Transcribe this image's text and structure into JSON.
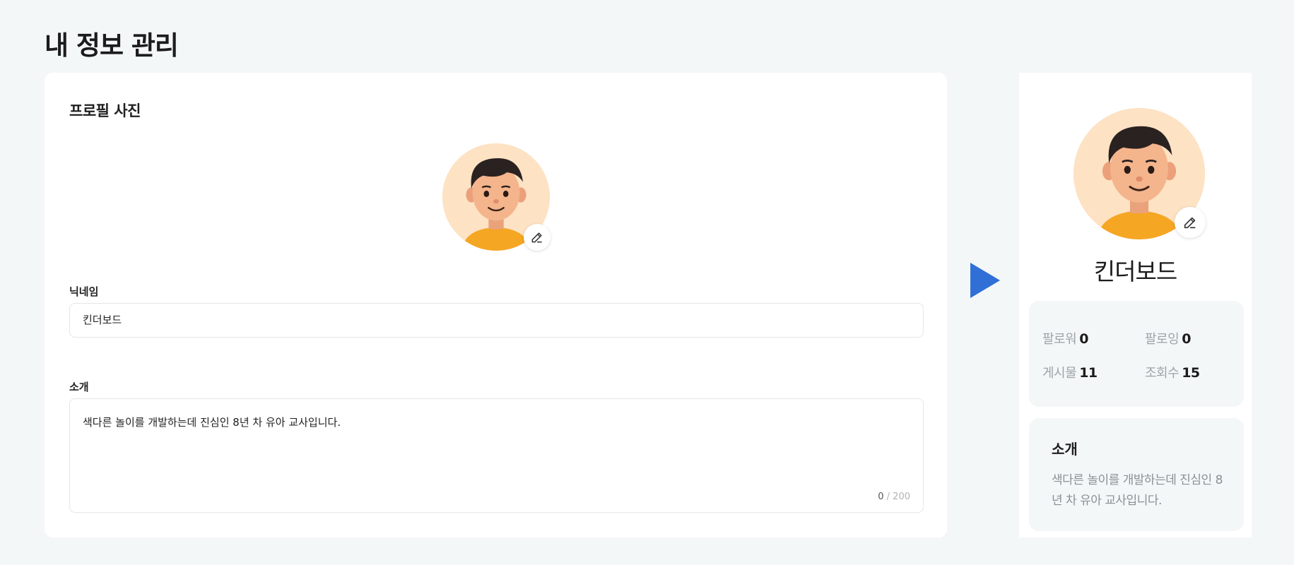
{
  "page": {
    "title": "내 정보 관리"
  },
  "profile_photo": {
    "section_title": "프로필 사진",
    "edit_icon": "pencil-icon"
  },
  "nickname": {
    "label": "닉네임",
    "value": "킨더보드"
  },
  "intro": {
    "label": "소개",
    "value": "색다른 놀이를 개발하는데 진심인 8년 차 유아 교사입니다.",
    "count_current": "0",
    "count_max": "/ 200"
  },
  "preview": {
    "name": "킨더보드",
    "stats": {
      "followers_label": "팔로워",
      "followers_value": "0",
      "following_label": "팔로잉",
      "following_value": "0",
      "posts_label": "게시물",
      "posts_value": "11",
      "views_label": "조회수",
      "views_value": "15"
    },
    "intro_title": "소개",
    "intro_text": "색다른 놀이를 개발하는데 진심인 8년 차 유아 교사입니다."
  },
  "colors": {
    "accent": "#2f6fd6",
    "background": "#f4f7f8",
    "avatar_bg": "#fde2c4",
    "shirt": "#f5a623"
  }
}
